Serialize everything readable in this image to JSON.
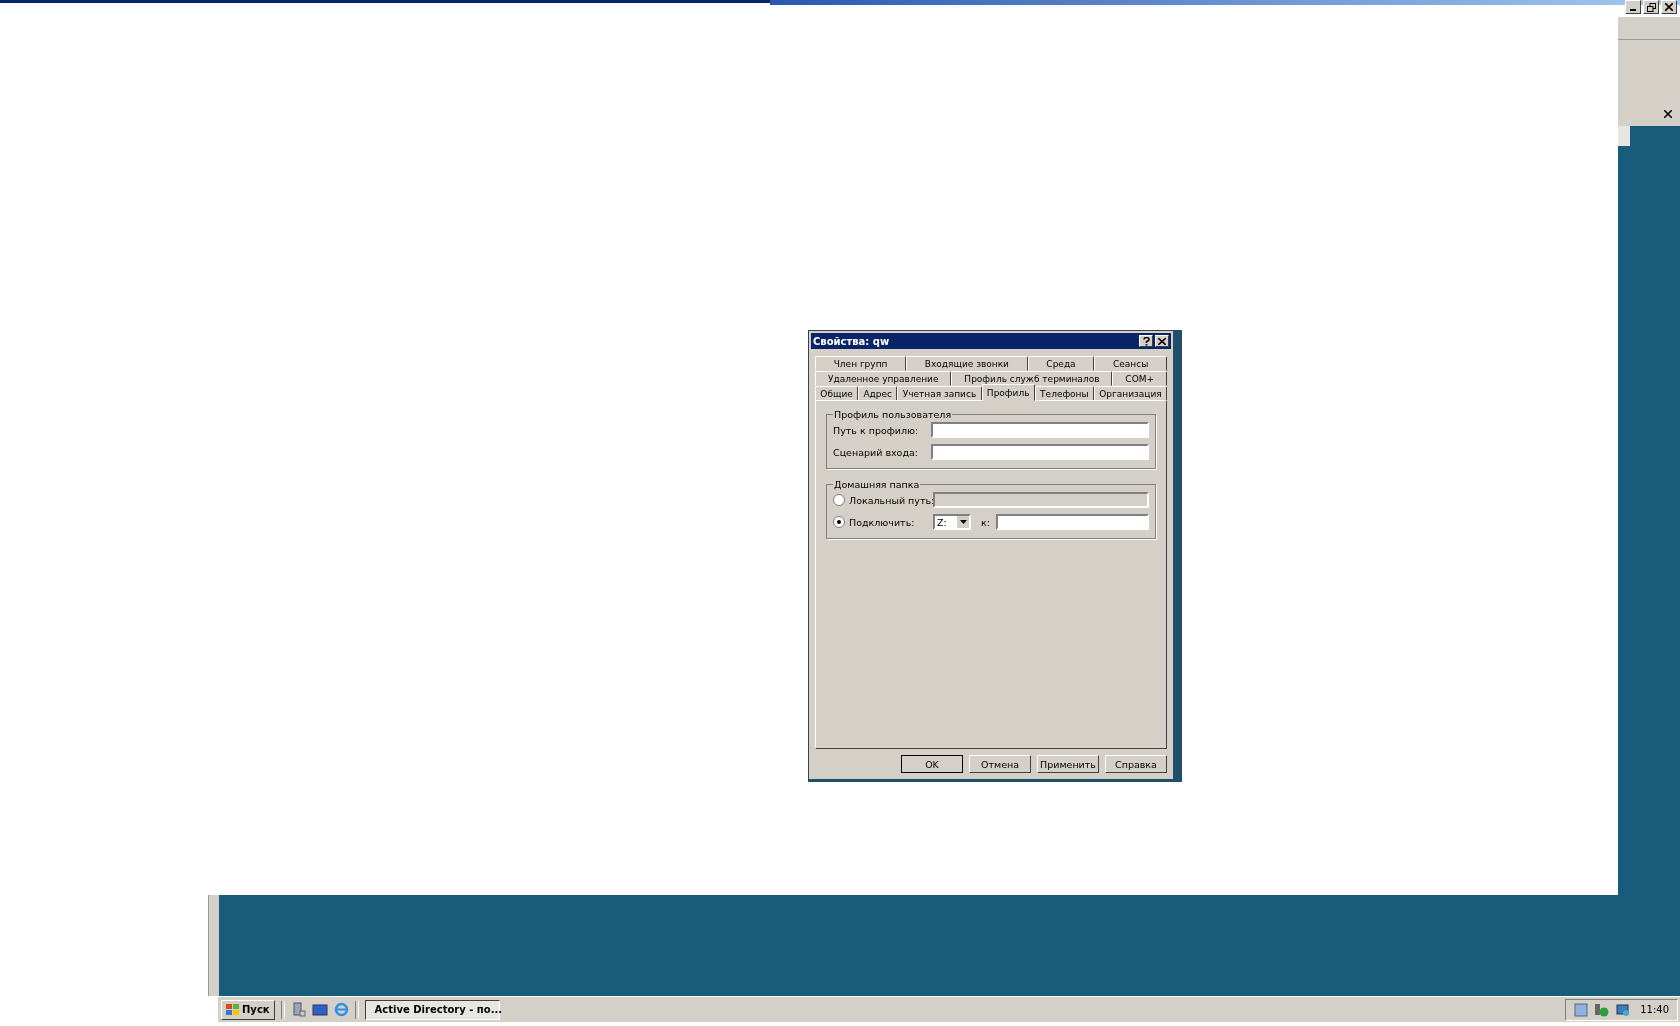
{
  "dialog": {
    "title": "Свойства: qw",
    "tab_rows": [
      [
        {
          "label": "Член групп",
          "selected": false
        },
        {
          "label": "Входящие звонки",
          "selected": false
        },
        {
          "label": "Среда",
          "selected": false
        },
        {
          "label": "Сеансы",
          "selected": false
        }
      ],
      [
        {
          "label": "Удаленное управление",
          "selected": false
        },
        {
          "label": "Профиль служб терминалов",
          "selected": false
        },
        {
          "label": "COM+",
          "selected": false
        }
      ],
      [
        {
          "label": "Общие",
          "selected": false
        },
        {
          "label": "Адрес",
          "selected": false
        },
        {
          "label": "Учетная запись",
          "selected": false
        },
        {
          "label": "Профиль",
          "selected": true
        },
        {
          "label": "Телефоны",
          "selected": false
        },
        {
          "label": "Организация",
          "selected": false
        }
      ]
    ],
    "user_profile": {
      "title": "Профиль пользователя",
      "fields": [
        {
          "label": "Путь к профилю:",
          "disabled": false
        },
        {
          "label": "Сценарий входа:",
          "disabled": false
        }
      ]
    },
    "home_folder": {
      "title": "Домашняя папка",
      "local_path": {
        "label": "Локальный путь:",
        "selected": false,
        "disabled": true
      },
      "connect": {
        "label": "Подключить:",
        "selected": true,
        "drive": "Z:",
        "to_label": "к:"
      }
    },
    "buttons": [
      {
        "label": "OK",
        "default": true
      },
      {
        "label": "Отмена",
        "default": false
      },
      {
        "label": "Применить",
        "default": false
      },
      {
        "label": "Справка",
        "default": false
      }
    ]
  },
  "taskbar": {
    "start": "Пуск",
    "tasks": [
      {
        "label": "Active Directory - по...",
        "selected": false
      }
    ],
    "clock": "11:40"
  }
}
